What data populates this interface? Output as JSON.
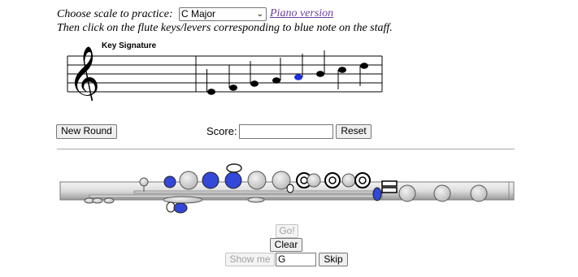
{
  "instructions": {
    "line1": "Choose scale to practice:",
    "line2": "Then click on the flute keys/levers corresponding to blue note on the staff."
  },
  "scale_select": {
    "selected": "C Major"
  },
  "piano_link": "Piano version",
  "staff": {
    "key_signature_label": "Key Signature"
  },
  "controls": {
    "new_round": "New Round",
    "score_label": "Score:",
    "score_value": "",
    "reset": "Reset"
  },
  "actions": {
    "go": "Go!",
    "clear": "Clear",
    "show_me": "Show me",
    "answer_value": "G",
    "skip": "Skip"
  },
  "colors": {
    "highlight": "#2b3fd6",
    "link": "#6a3fa0"
  },
  "icons": {
    "treble_clef": "treble-clef-icon",
    "select_arrow": "chevron-down-icon"
  }
}
